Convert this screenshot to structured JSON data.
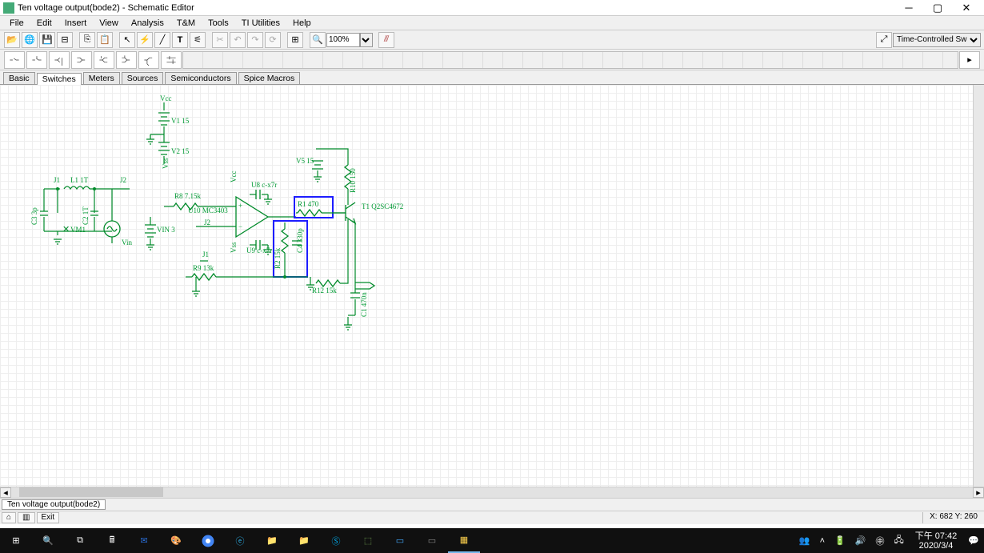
{
  "title": "Ten voltage output(bode2) - Schematic Editor",
  "menu": [
    "File",
    "Edit",
    "Insert",
    "View",
    "Analysis",
    "T&M",
    "Tools",
    "TI Utilities",
    "Help"
  ],
  "zoom": "100%",
  "toolbar_right_select": "Time-Controlled Switch",
  "tabs": [
    "Basic",
    "Switches",
    "Meters",
    "Sources",
    "Semiconductors",
    "Spice Macros"
  ],
  "active_tab": "Switches",
  "doc_tab": "Ten voltage output(bode2)",
  "status_buttons": [
    "⌂",
    "▥",
    "Exit"
  ],
  "coords": "X: 682 Y: 260",
  "components": {
    "J1": "J1",
    "L1": "L1 1T",
    "J2": "J2",
    "C3": "C3 3p",
    "C2": "C2 1T",
    "VM1": "VM1",
    "Vin": "Vin",
    "VIN": "VIN 3",
    "Vcc1": "Vcc",
    "Vcc2": "Vcc",
    "Vss1": "Vss",
    "Vss2": "Vss",
    "V1": "V1 15",
    "V2": "V2 15",
    "V5": "V5 15",
    "R8": "R8 7.15k",
    "U10": "U10 MC3403",
    "J2b": "J2",
    "J1b": "J1",
    "U8": "U8 c-x7r",
    "U9": "U9 c-x7r",
    "R1": "R1 470",
    "R2": "R2 15k",
    "C4": "C4 330p",
    "R9": "R9 13k",
    "R12": "R12 15k",
    "T1": "T1 Q2SC4672",
    "R10": "R10 150",
    "C1": "C1 470n"
  },
  "taskbar": {
    "items": [
      "start",
      "search",
      "task",
      "calc",
      "outlook",
      "paint",
      "chrome",
      "ie",
      "folder1",
      "folder2",
      "skype",
      "photo",
      "mail",
      "word",
      "ppt",
      "tina"
    ],
    "time": "下午 07:42",
    "date": "2020/3/4"
  }
}
